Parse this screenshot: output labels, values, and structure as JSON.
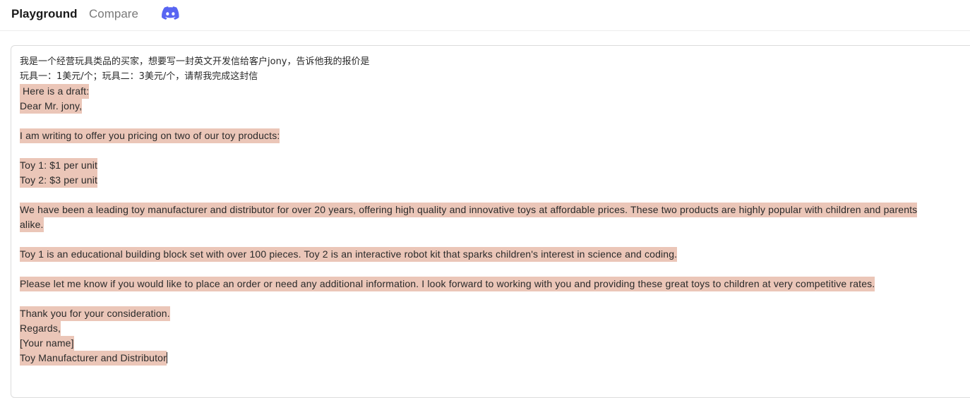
{
  "header": {
    "tabs": [
      {
        "label": "Playground",
        "active": true
      },
      {
        "label": "Compare",
        "active": false
      }
    ],
    "discord_icon": "discord-icon"
  },
  "editor": {
    "prompt": [
      "我是一个经营玩具类品的买家，想要写一封英文开发信给客户jony，告诉他我的报价是",
      "玩具一：1美元/个；玩具二：3美元/个，请帮我完成这封信"
    ],
    "response": {
      "intro": " Here is a draft:",
      "salutation": "Dear Mr. jony,",
      "p1": "I am writing to offer you pricing on two of our toy products:",
      "toy1": "Toy 1: $1 per unit",
      "toy2": "Toy 2: $3 per unit",
      "p2_line1": "We have been a leading toy manufacturer and distributor for over 20 years, offering high quality and innovative toys at affordable prices. These two products are highly popular with children and parents",
      "p2_line2": "alike.",
      "p3": "Toy 1 is an educational building block set with over 100 pieces. Toy 2 is an interactive robot kit that sparks children's interest in science and coding.",
      "p4": "Please let me know if you would like to place an order or need any additional information. I look forward to working with you and providing these great toys to children at very competitive rates.",
      "thanks": "Thank you for your consideration.",
      "regards": "Regards,",
      "name": "[Your name]",
      "title": "Toy Manufacturer and Distributor"
    },
    "highlight_color": "#ebc6b8"
  }
}
